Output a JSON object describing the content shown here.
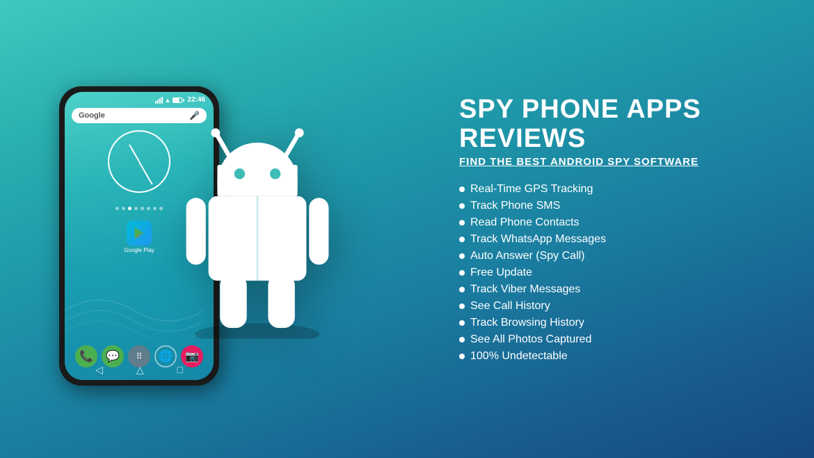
{
  "background": {
    "color_left": "#3dbcb8",
    "color_right": "#164880"
  },
  "phone": {
    "status": {
      "time": "22:46"
    },
    "search_bar": {
      "text": "Google",
      "mic": "🎤"
    },
    "app_icons": [
      {
        "name": "Google Play",
        "color": "#2196F3",
        "icon": "▶"
      }
    ],
    "nav_buttons": [
      "←",
      "□",
      "▭"
    ]
  },
  "header": {
    "title": "SPY PHONE APPS REVIEWS",
    "subtitle": "FIND THE BEST ANDROID SPY SOFTWARE"
  },
  "features": [
    {
      "text": "Real-Time GPS Tracking"
    },
    {
      "text": "Track Phone SMS"
    },
    {
      "text": "Read Phone Contacts"
    },
    {
      "text": "Track WhatsApp Messages"
    },
    {
      "text": "Auto Answer (Spy Call)"
    },
    {
      "text": "Free Update"
    },
    {
      "text": "Track Viber Messages"
    },
    {
      "text": "See Call History"
    },
    {
      "text": "Track Browsing History"
    },
    {
      "text": "See All Photos Captured"
    },
    {
      "text": "100% Undetectable"
    }
  ]
}
